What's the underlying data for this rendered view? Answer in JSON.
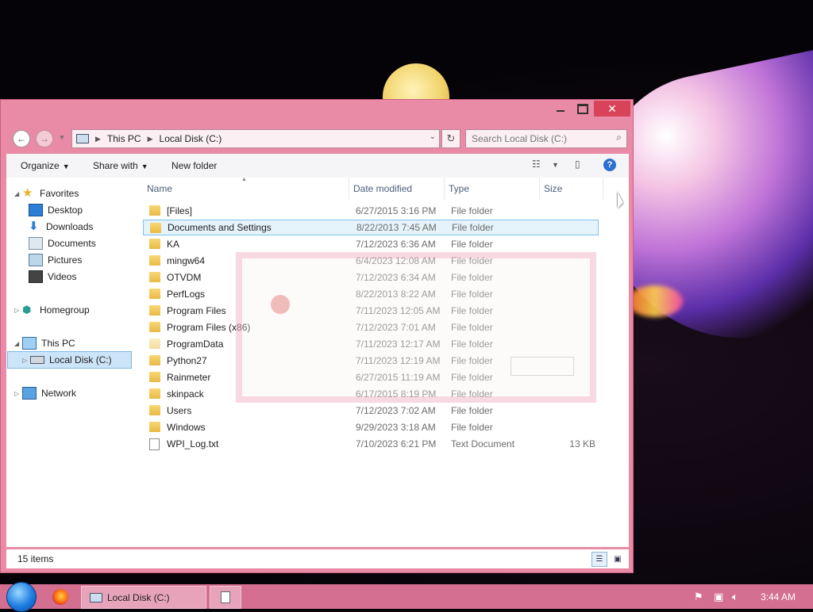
{
  "window": {
    "controls": {
      "minimize": "minimize",
      "maximize": "maximize",
      "close": "✕"
    }
  },
  "address": {
    "crumbs": [
      "This PC",
      "Local Disk (C:)"
    ],
    "search_placeholder": "Search Local Disk (C:)"
  },
  "toolbar": {
    "organize": "Organize",
    "share_with": "Share with",
    "new_folder": "New folder"
  },
  "nav": {
    "favorites": "Favorites",
    "desktop": "Desktop",
    "downloads": "Downloads",
    "documents": "Documents",
    "pictures": "Pictures",
    "videos": "Videos",
    "homegroup": "Homegroup",
    "this_pc": "This PC",
    "local_disk": "Local Disk (C:)",
    "network": "Network"
  },
  "columns": {
    "name": "Name",
    "date": "Date modified",
    "type": "Type",
    "size": "Size"
  },
  "files": [
    {
      "name": "[Files]",
      "date": "6/27/2015 3:16 PM",
      "type": "File folder",
      "size": ""
    },
    {
      "name": "Documents and Settings",
      "date": "8/22/2013 7:45 AM",
      "type": "File folder",
      "size": ""
    },
    {
      "name": "KA",
      "date": "7/12/2023 6:36 AM",
      "type": "File folder",
      "size": ""
    },
    {
      "name": "mingw64",
      "date": "6/4/2023 12:08 AM",
      "type": "File folder",
      "size": ""
    },
    {
      "name": "OTVDM",
      "date": "7/12/2023 6:34 AM",
      "type": "File folder",
      "size": ""
    },
    {
      "name": "PerfLogs",
      "date": "8/22/2013 8:22 AM",
      "type": "File folder",
      "size": ""
    },
    {
      "name": "Program Files",
      "date": "7/11/2023 12:05 AM",
      "type": "File folder",
      "size": ""
    },
    {
      "name": "Program Files (x86)",
      "date": "7/12/2023 7:01 AM",
      "type": "File folder",
      "size": ""
    },
    {
      "name": "ProgramData",
      "date": "7/11/2023 12:17 AM",
      "type": "File folder",
      "size": ""
    },
    {
      "name": "Python27",
      "date": "7/11/2023 12:19 AM",
      "type": "File folder",
      "size": ""
    },
    {
      "name": "Rainmeter",
      "date": "6/27/2015 11:19 AM",
      "type": "File folder",
      "size": ""
    },
    {
      "name": "skinpack",
      "date": "6/17/2015 8:19 PM",
      "type": "File folder",
      "size": ""
    },
    {
      "name": "Users",
      "date": "7/12/2023 7:02 AM",
      "type": "File folder",
      "size": ""
    },
    {
      "name": "Windows",
      "date": "9/29/2023 3:18 AM",
      "type": "File folder",
      "size": ""
    },
    {
      "name": "WPI_Log.txt",
      "date": "7/10/2023 6:21 PM",
      "type": "Text Document",
      "size": "13 KB"
    }
  ],
  "status": {
    "count": "15 items"
  },
  "taskbar": {
    "task_label": "Local Disk (C:)",
    "clock": "3:44 AM"
  },
  "colors": {
    "window_frame": "#e98aa6",
    "taskbar": "#d46f91",
    "selection": "#e5f3fb",
    "close": "#d8435a"
  },
  "icons": [
    "back-icon",
    "forward-icon",
    "refresh-icon",
    "search-icon",
    "help-icon",
    "folder-icon",
    "text-file-icon",
    "flag-icon",
    "network-icon",
    "volume-icon"
  ]
}
